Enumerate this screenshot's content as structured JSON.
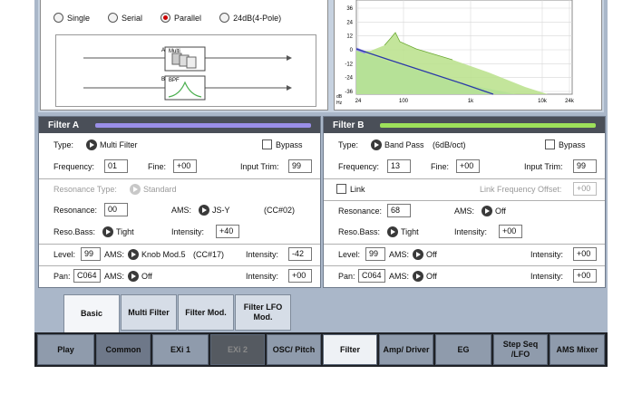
{
  "routing": {
    "options": [
      "Single",
      "Serial",
      "Parallel",
      "24dB(4-Pole)"
    ],
    "selected": "Parallel",
    "diagram": {
      "a_label": "A",
      "a_block": "Multi",
      "b_label": "B",
      "b_block": "BPF"
    }
  },
  "graph": {
    "y_ticks": [
      "36",
      "24",
      "12",
      "0",
      "-12",
      "-24",
      "-36"
    ],
    "y_unit": "dB",
    "x_unit": "Hz",
    "x_ticks": [
      "24",
      "100",
      "1k",
      "10k",
      "24k"
    ],
    "colors": {
      "filter_a": "#a9e5e2",
      "filter_b": "#b8e08a",
      "curve_a": "#2a3aa8"
    }
  },
  "filterA": {
    "title": "Filter A",
    "accent": "#9a8fe8",
    "type_label": "Type:",
    "type_value": "Multi Filter",
    "bypass_label": "Bypass",
    "frequency_label": "Frequency:",
    "frequency_value": "01",
    "fine_label": "Fine:",
    "fine_value": "+00",
    "input_trim_label": "Input Trim:",
    "input_trim_value": "99",
    "resonance_type_label": "Resonance Type:",
    "resonance_type_value": "Standard",
    "resonance_label": "Resonance:",
    "resonance_value": "00",
    "ams_label": "AMS:",
    "ams_value": "JS-Y",
    "ams_cc": "(CC#02)",
    "reso_bass_label": "Reso.Bass:",
    "reso_bass_value": "Tight",
    "intensity_label": "Intensity:",
    "intensity_value": "+40",
    "level_label": "Level:",
    "level_value": "99",
    "level_ams_label": "AMS:",
    "level_ams_value": "Knob Mod.5",
    "level_ams_cc": "(CC#17)",
    "level_intensity_label": "Intensity:",
    "level_intensity_value": "-42",
    "pan_label": "Pan:",
    "pan_value": "C064",
    "pan_ams_label": "AMS:",
    "pan_ams_value": "Off",
    "pan_intensity_label": "Intensity:",
    "pan_intensity_value": "+00"
  },
  "filterB": {
    "title": "Filter B",
    "accent": "#9de05a",
    "type_label": "Type:",
    "type_value": "Band Pass",
    "type_slope": "(6dB/oct)",
    "bypass_label": "Bypass",
    "frequency_label": "Frequency:",
    "frequency_value": "13",
    "fine_label": "Fine:",
    "fine_value": "+00",
    "input_trim_label": "Input Trim:",
    "input_trim_value": "99",
    "link_label": "Link",
    "link_offset_label": "Link Frequency Offset:",
    "link_offset_value": "+00",
    "resonance_label": "Resonance:",
    "resonance_value": "68",
    "ams_label": "AMS:",
    "ams_value": "Off",
    "reso_bass_label": "Reso.Bass:",
    "reso_bass_value": "Tight",
    "intensity_label": "Intensity:",
    "intensity_value": "+00",
    "level_label": "Level:",
    "level_value": "99",
    "level_ams_label": "AMS:",
    "level_ams_value": "Off",
    "level_intensity_label": "Intensity:",
    "level_intensity_value": "+00",
    "pan_label": "Pan:",
    "pan_value": "C064",
    "pan_ams_label": "AMS:",
    "pan_ams_value": "Off",
    "pan_intensity_label": "Intensity:",
    "pan_intensity_value": "+00"
  },
  "subtabs": [
    "Basic",
    "Multi Filter",
    "Filter Mod.",
    "Filter LFO Mod."
  ],
  "active_subtab": "Basic",
  "modes": [
    "Play",
    "Common",
    "EXi 1",
    "EXi 2",
    "OSC/ Pitch",
    "Filter",
    "Amp/ Driver",
    "EG",
    "Step Seq /LFO",
    "AMS Mixer"
  ],
  "active_mode": "Filter",
  "disabled_mode": "EXi 2"
}
